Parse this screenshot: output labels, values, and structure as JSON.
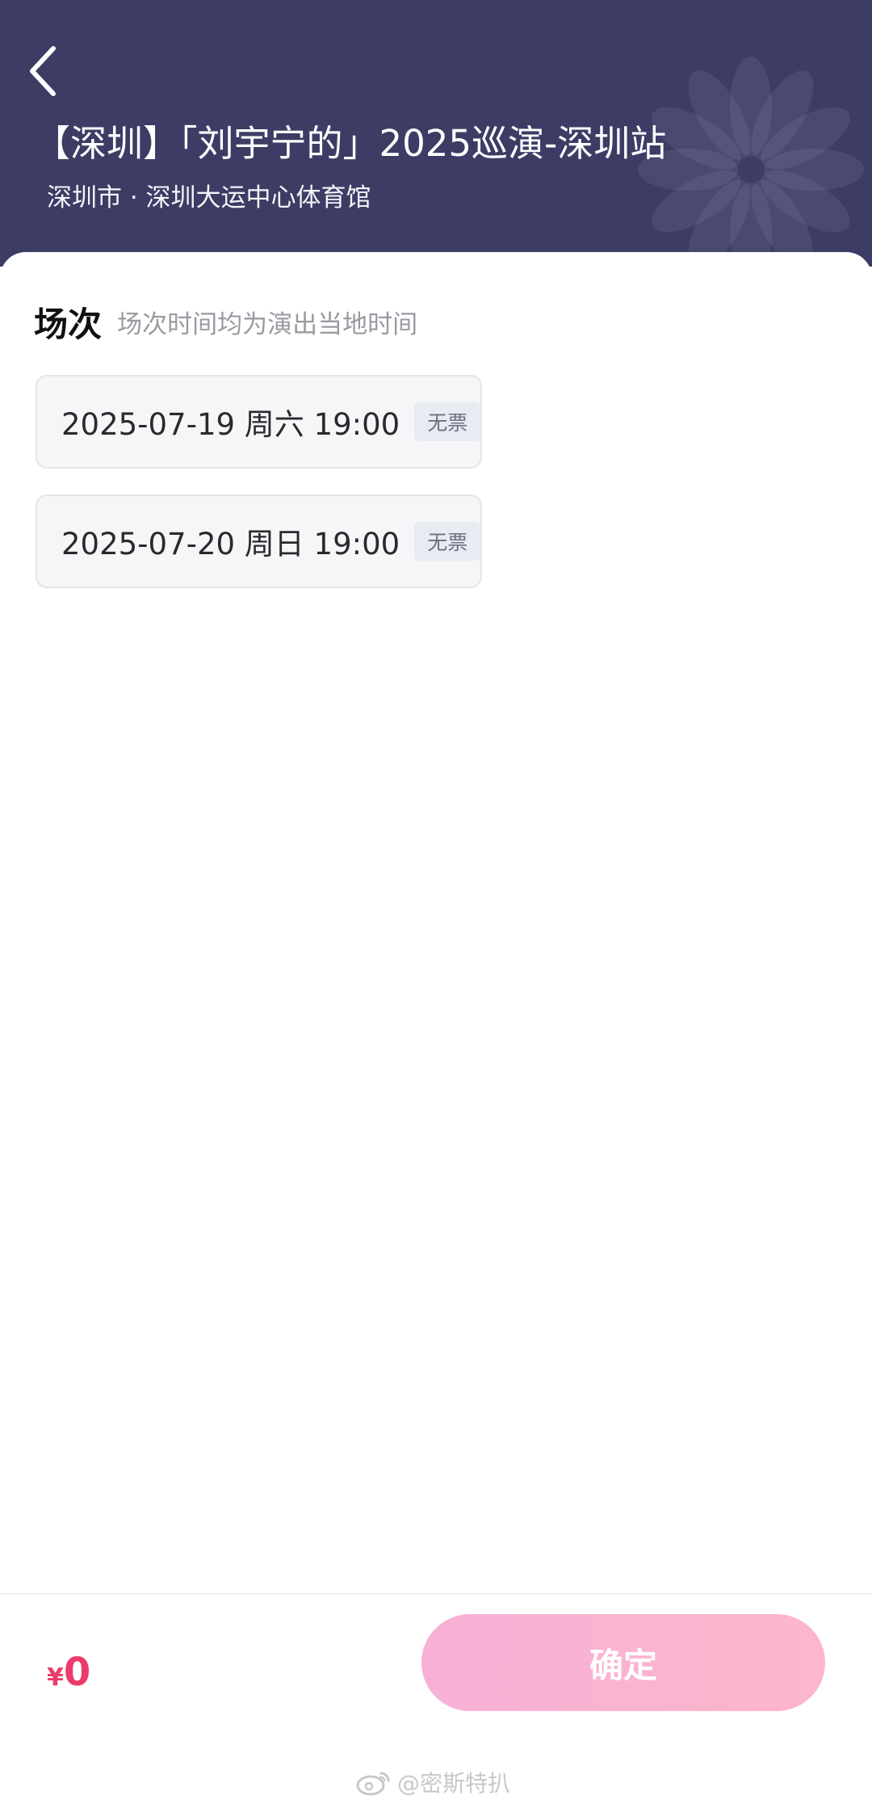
{
  "header": {
    "title": "【深圳】「刘宇宁的」2025巡演-深圳站",
    "venue": "深圳市 · 深圳大运中心体育馆",
    "back_icon": "chevron-left-icon",
    "background_color": "#3d3c65"
  },
  "sessions_section": {
    "title": "场次",
    "hint": "场次时间均为演出当地时间",
    "items": [
      {
        "datetime": "2025-07-19 周六 19:00",
        "status": "无票"
      },
      {
        "datetime": "2025-07-20 周日 19:00",
        "status": "无票"
      }
    ]
  },
  "footer": {
    "currency_symbol": "¥",
    "price": "0",
    "confirm_label": "确定",
    "price_color": "#ec3b6a"
  },
  "watermark": {
    "icon": "weibo-icon",
    "text": "@密斯特扒"
  }
}
